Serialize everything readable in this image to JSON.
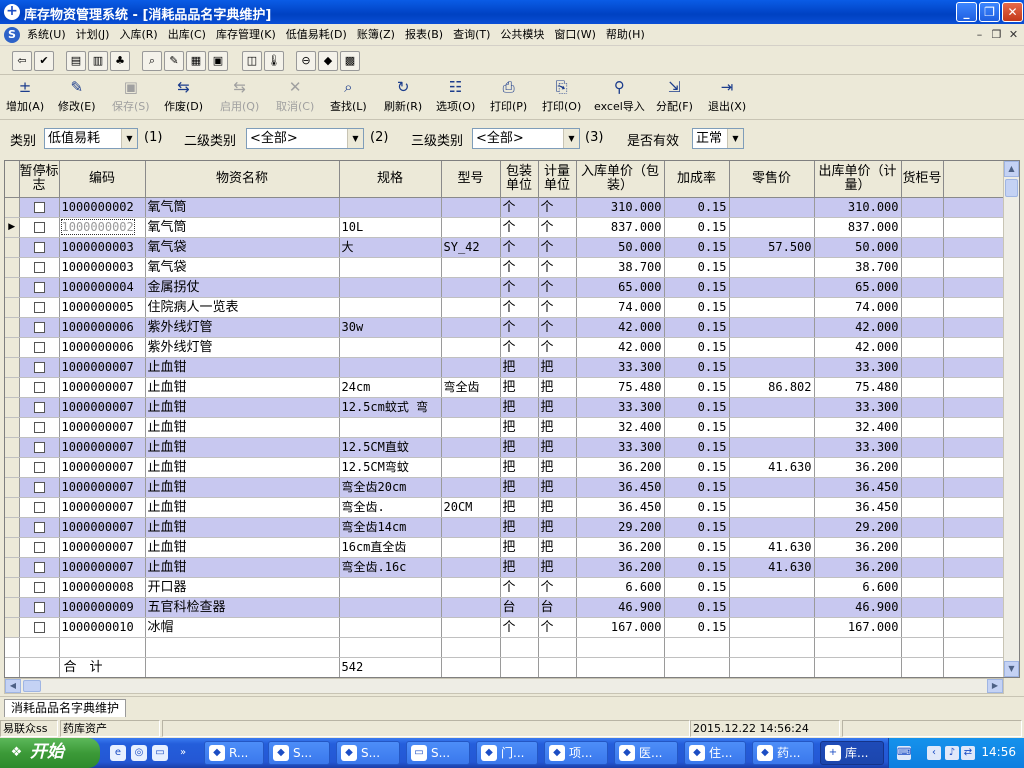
{
  "window": {
    "title": "库存物资管理系统 - [消耗品品名字典维护]",
    "icon": "plus-circle-icon"
  },
  "menu": [
    "系统(U)",
    "计划(J)",
    "入库(R)",
    "出库(C)",
    "库存管理(K)",
    "低值易耗(D)",
    "账簿(Z)",
    "报表(B)",
    "查询(T)",
    "公共模块",
    "窗口(W)",
    "帮助(H)"
  ],
  "toolbar": [
    {
      "label": "增加(A)",
      "icon": "add-icon",
      "enabled": true
    },
    {
      "label": "修改(E)",
      "icon": "edit-icon",
      "enabled": true
    },
    {
      "label": "保存(S)",
      "icon": "save-icon",
      "enabled": false
    },
    {
      "label": "作废(D)",
      "icon": "void-icon",
      "enabled": true
    },
    {
      "label": "启用(Q)",
      "icon": "enable-icon",
      "enabled": false
    },
    {
      "label": "取消(C)",
      "icon": "cancel-icon",
      "enabled": false
    },
    {
      "label": "查找(L)",
      "icon": "search-icon",
      "enabled": true
    },
    {
      "label": "刷新(R)",
      "icon": "refresh-icon",
      "enabled": true
    },
    {
      "label": "选项(O)",
      "icon": "options-icon",
      "enabled": true
    },
    {
      "label": "打印(P)",
      "icon": "printer-icon",
      "enabled": true
    },
    {
      "label": "打印(O)",
      "icon": "print-preview-icon",
      "enabled": true
    },
    {
      "label": "excel导入",
      "icon": "excel-import-icon",
      "enabled": true
    },
    {
      "label": "分配(F)",
      "icon": "assign-icon",
      "enabled": true
    },
    {
      "label": "退出(X)",
      "icon": "exit-icon",
      "enabled": true
    }
  ],
  "filters": {
    "category_label": "类别",
    "category_value": "低值易耗",
    "category_hint": "(1)",
    "sub_label": "二级类别",
    "sub_value": "<全部>",
    "sub_hint": "(2)",
    "third_label": "三级类别",
    "third_value": "<全部>",
    "third_hint": "(3)",
    "valid_label": "是否有效",
    "valid_value": "正常"
  },
  "table": {
    "headers": [
      "暂停标志",
      "编码",
      "物资名称",
      "规格",
      "型号",
      "包装单位",
      "计量单位",
      "入库单价（包装）",
      "加成率",
      "零售价",
      "出库单价（计量）",
      "货柜号"
    ],
    "rows": [
      {
        "code": "1000000002",
        "name": "氧气筒",
        "spec": "",
        "model": "",
        "pack": "个",
        "unit": "个",
        "in_price": "310.000",
        "markup": "0.15",
        "retail": "",
        "out_price": "310.000"
      },
      {
        "code": "1000000002",
        "name": "氧气筒",
        "spec": "10L",
        "model": "",
        "pack": "个",
        "unit": "个",
        "in_price": "837.000",
        "markup": "0.15",
        "retail": "",
        "out_price": "837.000"
      },
      {
        "code": "1000000003",
        "name": "氧气袋",
        "spec": "大",
        "model": "SY_42",
        "pack": "个",
        "unit": "个",
        "in_price": "50.000",
        "markup": "0.15",
        "retail": "57.500",
        "out_price": "50.000"
      },
      {
        "code": "1000000003",
        "name": "氧气袋",
        "spec": "",
        "model": "",
        "pack": "个",
        "unit": "个",
        "in_price": "38.700",
        "markup": "0.15",
        "retail": "",
        "out_price": "38.700"
      },
      {
        "code": "1000000004",
        "name": "金属拐仗",
        "spec": "",
        "model": "",
        "pack": "个",
        "unit": "个",
        "in_price": "65.000",
        "markup": "0.15",
        "retail": "",
        "out_price": "65.000"
      },
      {
        "code": "1000000005",
        "name": "住院病人一览表",
        "spec": "",
        "model": "",
        "pack": "个",
        "unit": "个",
        "in_price": "74.000",
        "markup": "0.15",
        "retail": "",
        "out_price": "74.000"
      },
      {
        "code": "1000000006",
        "name": "紫外线灯管",
        "spec": "30w",
        "model": "",
        "pack": "个",
        "unit": "个",
        "in_price": "42.000",
        "markup": "0.15",
        "retail": "",
        "out_price": "42.000"
      },
      {
        "code": "1000000006",
        "name": "紫外线灯管",
        "spec": "",
        "model": "",
        "pack": "个",
        "unit": "个",
        "in_price": "42.000",
        "markup": "0.15",
        "retail": "",
        "out_price": "42.000"
      },
      {
        "code": "1000000007",
        "name": "止血钳",
        "spec": "",
        "model": "",
        "pack": "把",
        "unit": "把",
        "in_price": "33.300",
        "markup": "0.15",
        "retail": "",
        "out_price": "33.300"
      },
      {
        "code": "1000000007",
        "name": "止血钳",
        "spec": "24cm",
        "model": "弯全齿",
        "pack": "把",
        "unit": "把",
        "in_price": "75.480",
        "markup": "0.15",
        "retail": "86.802",
        "out_price": "75.480"
      },
      {
        "code": "1000000007",
        "name": "止血钳",
        "spec": "12.5cm蚊式 弯",
        "model": "",
        "pack": "把",
        "unit": "把",
        "in_price": "33.300",
        "markup": "0.15",
        "retail": "",
        "out_price": "33.300"
      },
      {
        "code": "1000000007",
        "name": "止血钳",
        "spec": "",
        "model": "",
        "pack": "把",
        "unit": "把",
        "in_price": "32.400",
        "markup": "0.15",
        "retail": "",
        "out_price": "32.400"
      },
      {
        "code": "1000000007",
        "name": "止血钳",
        "spec": "12.5CM直蚊",
        "model": "",
        "pack": "把",
        "unit": "把",
        "in_price": "33.300",
        "markup": "0.15",
        "retail": "",
        "out_price": "33.300"
      },
      {
        "code": "1000000007",
        "name": "止血钳",
        "spec": "12.5CM弯蚊",
        "model": "",
        "pack": "把",
        "unit": "把",
        "in_price": "36.200",
        "markup": "0.15",
        "retail": "41.630",
        "out_price": "36.200"
      },
      {
        "code": "1000000007",
        "name": "止血钳",
        "spec": "弯全齿20cm",
        "model": "",
        "pack": "把",
        "unit": "把",
        "in_price": "36.450",
        "markup": "0.15",
        "retail": "",
        "out_price": "36.450"
      },
      {
        "code": "1000000007",
        "name": "止血钳",
        "spec": "弯全齿.",
        "model": "20CM",
        "pack": "把",
        "unit": "把",
        "in_price": "36.450",
        "markup": "0.15",
        "retail": "",
        "out_price": "36.450"
      },
      {
        "code": "1000000007",
        "name": "止血钳",
        "spec": "弯全齿14cm",
        "model": "",
        "pack": "把",
        "unit": "把",
        "in_price": "29.200",
        "markup": "0.15",
        "retail": "",
        "out_price": "29.200"
      },
      {
        "code": "1000000007",
        "name": "止血钳",
        "spec": "16cm直全齿",
        "model": "",
        "pack": "把",
        "unit": "把",
        "in_price": "36.200",
        "markup": "0.15",
        "retail": "41.630",
        "out_price": "36.200"
      },
      {
        "code": "1000000007",
        "name": "止血钳",
        "spec": "弯全齿.16c",
        "model": "",
        "pack": "把",
        "unit": "把",
        "in_price": "36.200",
        "markup": "0.15",
        "retail": "41.630",
        "out_price": "36.200"
      },
      {
        "code": "1000000008",
        "name": "开口器",
        "spec": "",
        "model": "",
        "pack": "个",
        "unit": "个",
        "in_price": "6.600",
        "markup": "0.15",
        "retail": "",
        "out_price": "6.600"
      },
      {
        "code": "1000000009",
        "name": "五官科检查器",
        "spec": "",
        "model": "",
        "pack": "台",
        "unit": "台",
        "in_price": "46.900",
        "markup": "0.15",
        "retail": "",
        "out_price": "46.900"
      },
      {
        "code": "1000000010",
        "name": "冰帽",
        "spec": "",
        "model": "",
        "pack": "个",
        "unit": "个",
        "in_price": "167.000",
        "markup": "0.15",
        "retail": "",
        "out_price": "167.000"
      }
    ],
    "selected_row": 1,
    "total_label": "合　计",
    "total_value": "542"
  },
  "doc_tab": "消耗品品名字典维护",
  "status": {
    "user": "易联众ss",
    "dept": "药库资产",
    "datetime": "2015.12.22 14:56:24"
  },
  "taskbar": {
    "start": "开始",
    "items": [
      {
        "label": "R...",
        "icon": "app-icon",
        "active": false
      },
      {
        "label": "S...",
        "icon": "app-icon",
        "active": false
      },
      {
        "label": "S...",
        "icon": "app-icon",
        "active": false
      },
      {
        "label": "S...",
        "icon": "folder-icon",
        "active": false
      },
      {
        "label": "门...",
        "icon": "app-icon",
        "active": false
      },
      {
        "label": "项...",
        "icon": "app-icon",
        "active": false
      },
      {
        "label": "医...",
        "icon": "app-icon",
        "active": false
      },
      {
        "label": "住...",
        "icon": "app-icon",
        "active": false
      },
      {
        "label": "药...",
        "icon": "app-icon",
        "active": false
      },
      {
        "label": "库...",
        "icon": "plus-circle-icon",
        "active": true
      }
    ],
    "clock": "14:56"
  }
}
